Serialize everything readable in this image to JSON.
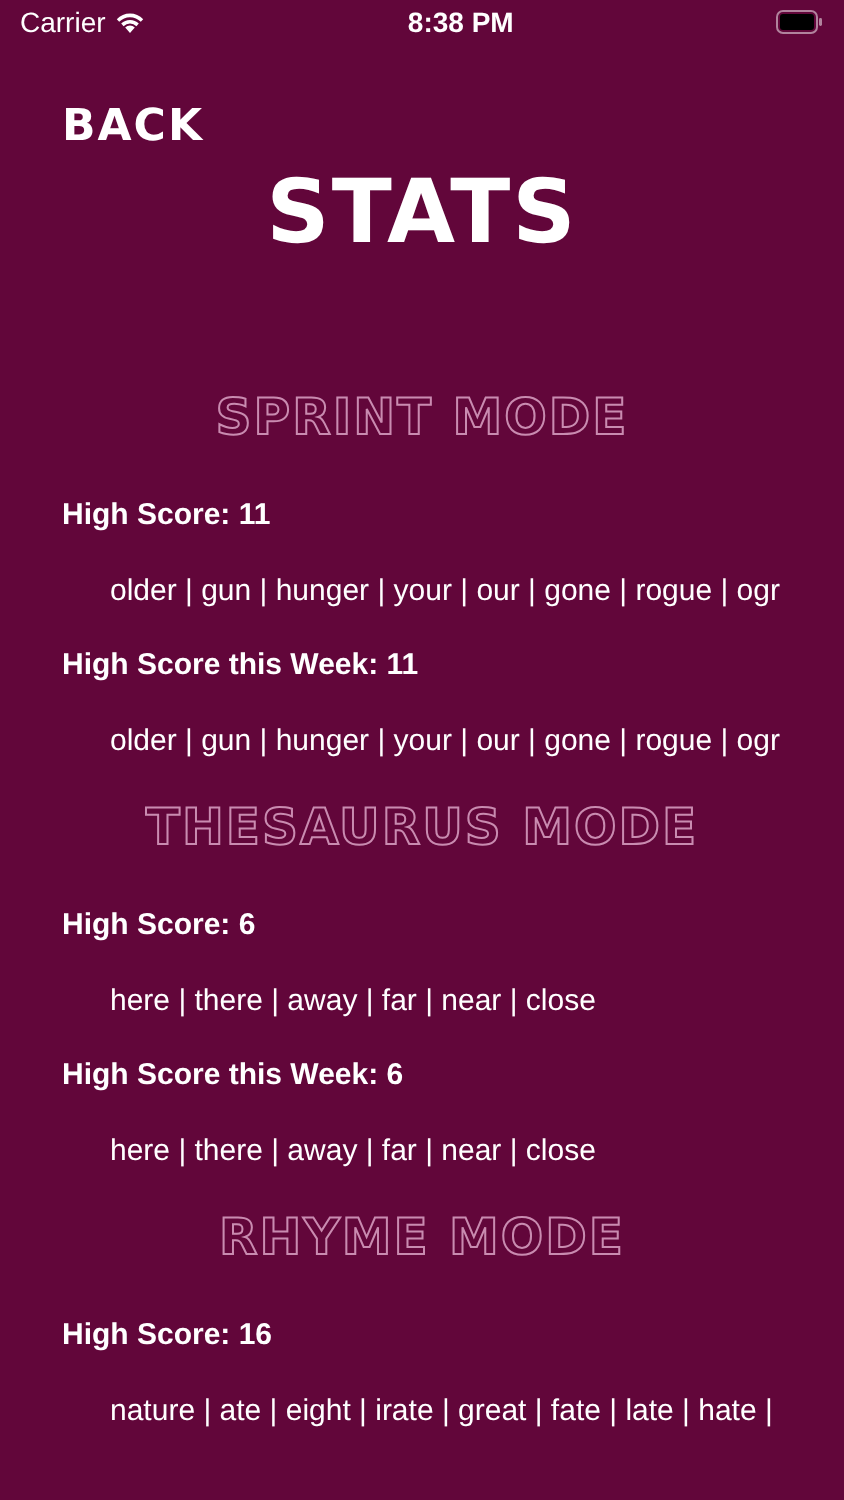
{
  "status_bar": {
    "carrier": "Carrier",
    "time": "8:38 PM"
  },
  "back": "BACK",
  "title": "STATS",
  "sections": [
    {
      "title": "SPRINT MODE",
      "rows": [
        {
          "label": "High Score: 11",
          "words": "older | gun | hunger | your | our | gone | rogue | ogr"
        },
        {
          "label": "High Score this Week: 11",
          "words": "older | gun | hunger | your | our | gone | rogue | ogr"
        }
      ]
    },
    {
      "title": "THESAURUS MODE",
      "rows": [
        {
          "label": "High Score: 6",
          "words": "here | there | away | far | near | close"
        },
        {
          "label": "High Score this Week: 6",
          "words": "here | there | away | far | near | close"
        }
      ]
    },
    {
      "title": "RHYME MODE",
      "rows": [
        {
          "label": "High Score: 16",
          "words": "nature | ate | eight | irate | great | fate | late | hate |"
        }
      ]
    }
  ]
}
